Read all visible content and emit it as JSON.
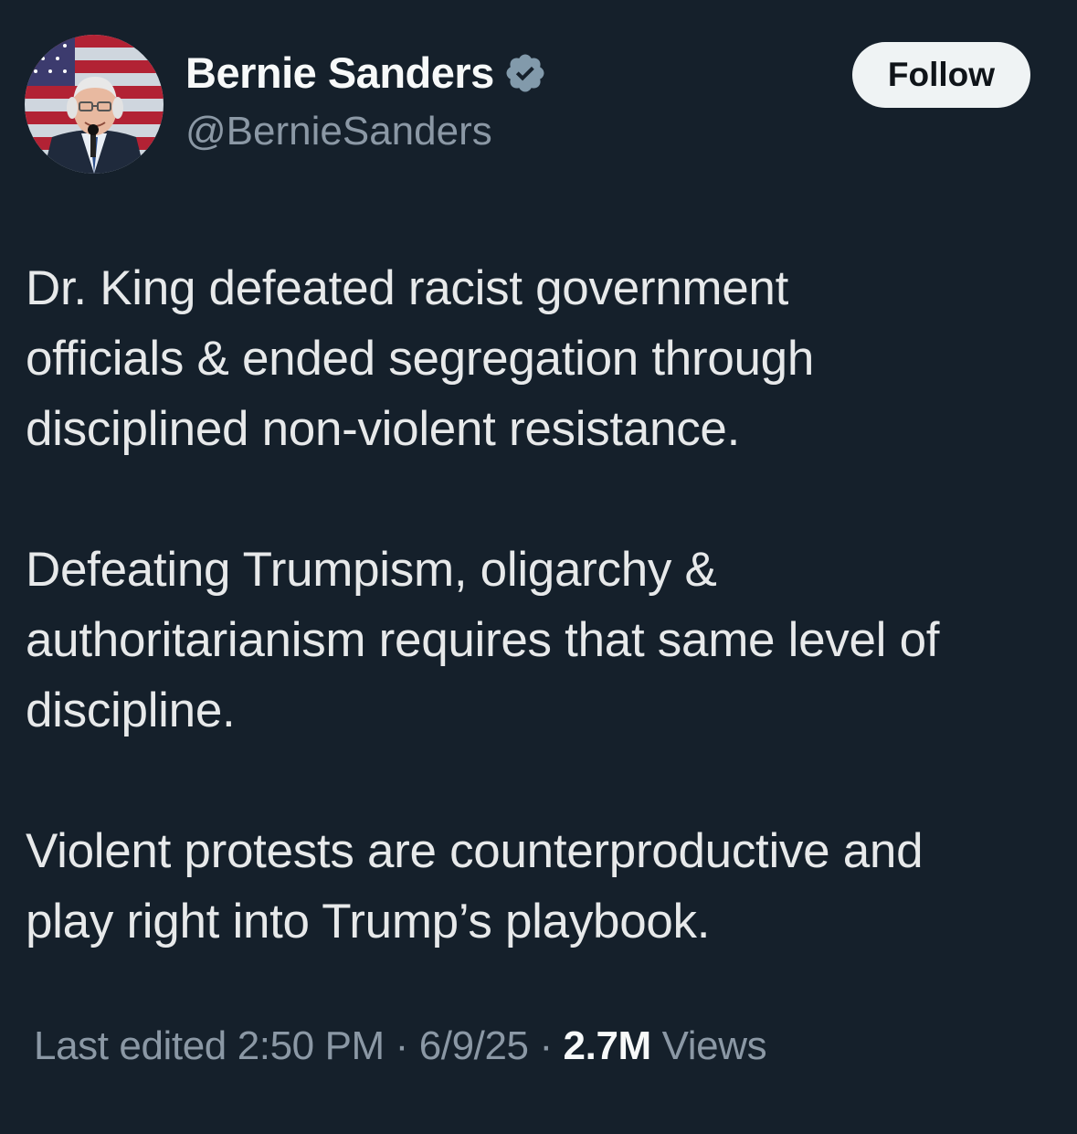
{
  "author": {
    "name": "Bernie Sanders",
    "handle": "@BernieSanders",
    "verified_icon": "verified-badge-icon"
  },
  "follow_button": {
    "label": "Follow"
  },
  "tweet": {
    "paragraphs": [
      [
        "Dr. King defeated racist government",
        "officials & ended segregation through",
        "disciplined non-violent resistance."
      ],
      [
        "Defeating Trumpism, oligarchy &",
        "authoritarianism requires that same level of",
        "discipline."
      ],
      [
        "Violent protests are counterproductive and",
        "play right into Trump’s playbook."
      ]
    ]
  },
  "meta": {
    "edited_label": "Last edited",
    "time": "2:50 PM",
    "sep1": "·",
    "date": "6/9/25",
    "sep2": "·",
    "views_count": "2.7M",
    "views_label": "Views"
  },
  "colors": {
    "background": "#15202b",
    "text": "#e7e9ea",
    "muted": "#8b98a5",
    "verified": "#829aab",
    "button_bg": "#eff3f4"
  }
}
